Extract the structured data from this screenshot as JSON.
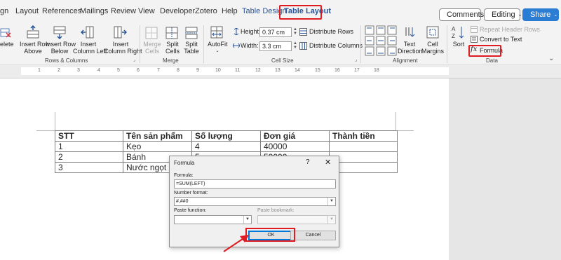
{
  "tabs": [
    {
      "label": "gn",
      "accent": false
    },
    {
      "label": "Layout",
      "accent": false
    },
    {
      "label": "References",
      "accent": false
    },
    {
      "label": "Mailings",
      "accent": false
    },
    {
      "label": "Review",
      "accent": false
    },
    {
      "label": "View",
      "accent": false
    },
    {
      "label": "Developer",
      "accent": false
    },
    {
      "label": "Zotero",
      "accent": false
    },
    {
      "label": "Help",
      "accent": false
    },
    {
      "label": "Table Design",
      "accent": true
    },
    {
      "label": "Table Layout",
      "accent": true
    }
  ],
  "top_right": {
    "comments": "Comments",
    "editing": "Editing",
    "share": "Share"
  },
  "ribbon": {
    "rows_columns": {
      "delete": [
        "elete",
        ""
      ],
      "insert_row_above": [
        "Insert Row",
        "Above"
      ],
      "insert_row_below": [
        "Insert Row",
        "Below"
      ],
      "insert_column_left": [
        "Insert",
        "Column Left"
      ],
      "insert_column_right": [
        "Insert",
        "Column Right"
      ],
      "group_label": "Rows & Columns"
    },
    "merge": {
      "merge_cells": [
        "Merge",
        "Cells"
      ],
      "split_cells": [
        "Split",
        "Cells"
      ],
      "split_table": [
        "Split",
        "Table"
      ],
      "group_label": "Merge"
    },
    "cell_size": {
      "autofit": "AutoFit",
      "height_label": "Height:",
      "height_value": "0.37 cm",
      "width_label": "Width:",
      "width_value": "3.3 cm",
      "distribute_rows": "Distribute Rows",
      "distribute_columns": "Distribute Columns",
      "group_label": "Cell Size"
    },
    "alignment": {
      "text_direction": [
        "Text",
        "Direction"
      ],
      "cell_margins": [
        "Cell",
        "Margins"
      ],
      "group_label": "Alignment"
    },
    "data": {
      "sort": "Sort",
      "repeat_header_rows": "Repeat Header Rows",
      "convert_to_text": "Convert to Text",
      "formula": "Formula",
      "group_label": "Data"
    }
  },
  "ruler_marks": [
    "1",
    "2",
    "3",
    "4",
    "5",
    "6",
    "7",
    "8",
    "9",
    "10",
    "11",
    "12",
    "13",
    "14",
    "15",
    "16",
    "17",
    "18"
  ],
  "table": {
    "header": [
      "STT",
      "Tên sản phẩm",
      "Số lượng",
      "Đơn giá",
      "Thành tiền"
    ],
    "rows": [
      [
        "1",
        "Kẹo",
        "4",
        "40000",
        ""
      ],
      [
        "2",
        "Bánh",
        "5",
        "50000",
        ""
      ],
      [
        "3",
        "Nước ngọt",
        "",
        "",
        ""
      ]
    ]
  },
  "dialog": {
    "title": "Formula",
    "help": "?",
    "close": "✕",
    "formula_label": "Formula:",
    "formula_value": "=SUM(LEFT)",
    "number_format_label": "Number format:",
    "number_format_value": "#,##0",
    "paste_function_label": "Paste function:",
    "paste_bookmark_label": "Paste bookmark:",
    "ok": "OK",
    "cancel": "Cancel"
  },
  "colors": {
    "highlight": "#e01b22",
    "accent": "#2b579a",
    "share": "#2b7cd3"
  }
}
